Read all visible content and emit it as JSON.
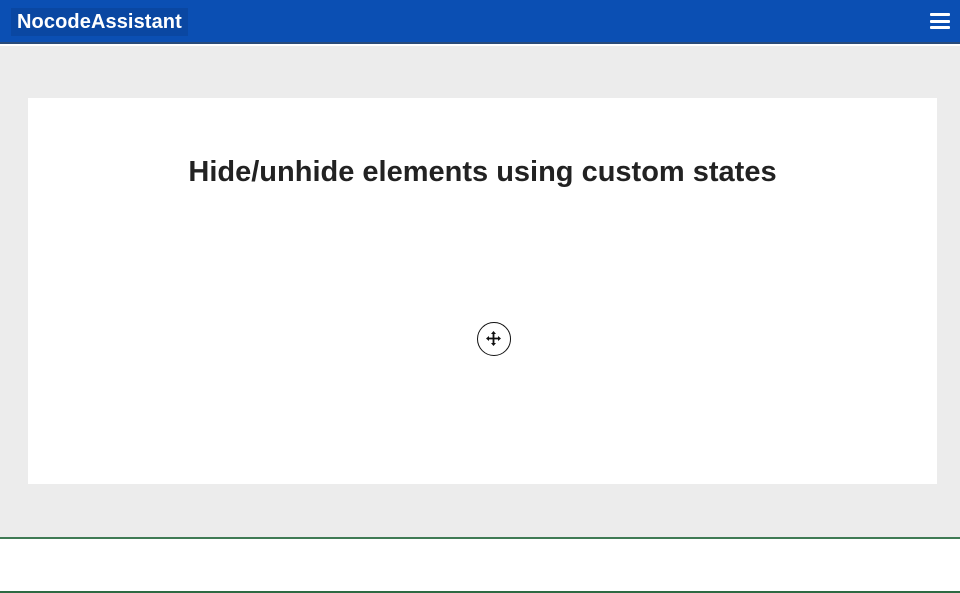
{
  "header": {
    "brand": "NocodeAssistant",
    "menu_icon": "hamburger-menu-icon"
  },
  "main": {
    "title": "Hide/unhide elements using custom states",
    "cursor_icon": "move-cursor-icon"
  },
  "colors": {
    "header_bg": "#0b4fb3",
    "page_bg": "#ececec",
    "card_bg": "#ffffff",
    "title_text": "#222222",
    "divider": "#3f7a54"
  }
}
